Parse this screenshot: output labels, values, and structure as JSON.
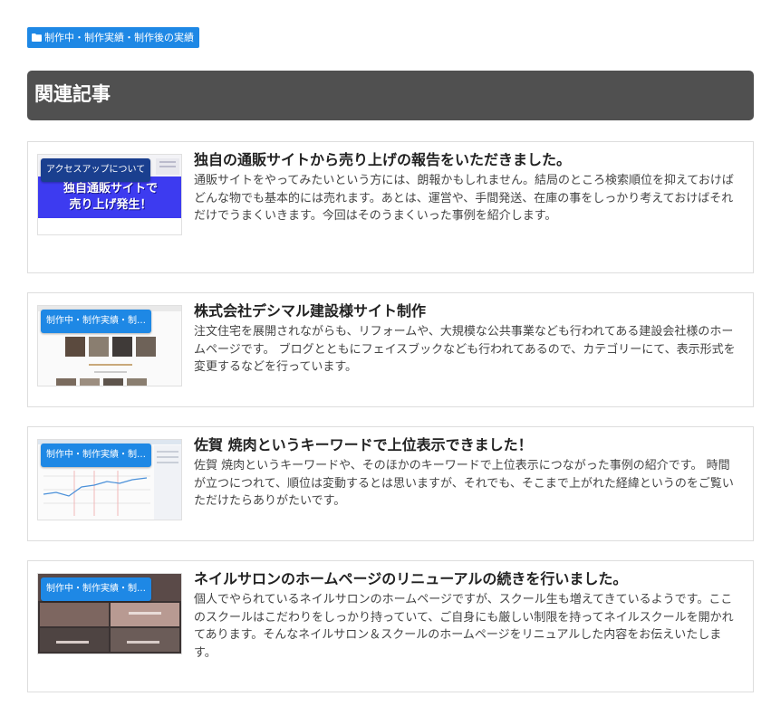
{
  "category": {
    "icon": "folder-icon",
    "label": "制作中・制作実績・制作後の実績"
  },
  "related": {
    "title": "関連記事"
  },
  "articles": [
    {
      "badge": "アクセスアップについて",
      "thumb_text": "独自通販サイトで\n売り上げ発生！",
      "title": "独自の通販サイトから売り上げの報告をいただきました。",
      "excerpt": "通販サイトをやってみたいという方には、朗報かもしれません。結局のところ検索順位を抑えておけばどんな物でも基本的には売れます。あとは、運営や、手間発送、在庫の事をしっかり考えておけばそれだけでうまくいきます。今回はそのうまくいった事例を紹介します。"
    },
    {
      "badge": "制作中・制作実績・制…",
      "title": "株式会社デシマル建設様サイト制作",
      "excerpt": "注文住宅を展開されながらも、リフォームや、大規模な公共事業なども行われてある建設会社様のホームページです。 ブログとともにフェイスブックなども行われてあるので、カテゴリーにて、表示形式を変更するなどを行っています。"
    },
    {
      "badge": "制作中・制作実績・制…",
      "title": "佐賀 焼肉というキーワードで上位表示できました！",
      "excerpt": "佐賀 焼肉というキーワードや、そのほかのキーワードで上位表示につながった事例の紹介です。 時間が立つにつれて、順位は変動するとは思いますが、それでも、そこまで上がれた経緯というのをご覧いただけたらありがたいです。"
    },
    {
      "badge": "制作中・制作実績・制…",
      "title": "ネイルサロンのホームページのリニューアルの続きを行いました。",
      "excerpt": "個人でやられているネイルサロンのホームページですが、スクール生も増えてきているようです。ここのスクールはこだわりをしっかり持っていて、ご自身にも厳しい制限を持ってネイルスクールを開かれてあります。そんなネイルサロン＆スクールのホームページをリニュアルした内容をお伝えいたします。"
    }
  ]
}
